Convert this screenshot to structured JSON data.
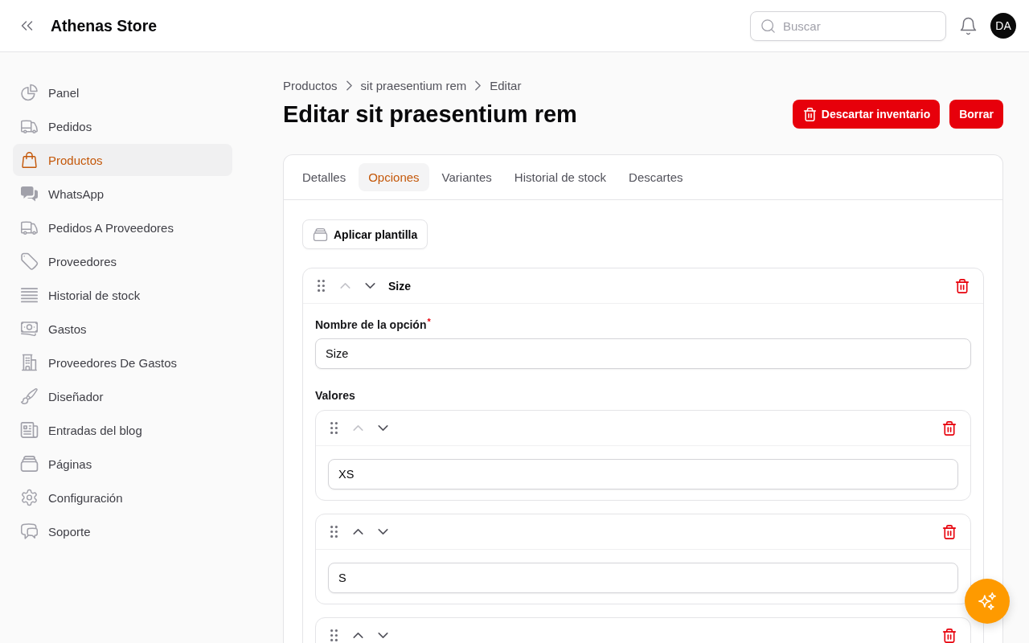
{
  "header": {
    "title": "Athenas Store",
    "search": {
      "placeholder": "Buscar"
    },
    "avatar": "DA"
  },
  "sidebar": {
    "items": [
      {
        "label": "Panel",
        "selected": false
      },
      {
        "label": "Pedidos",
        "selected": false
      },
      {
        "label": "Productos",
        "selected": true
      },
      {
        "label": "WhatsApp",
        "selected": false
      },
      {
        "label": "Pedidos A Proveedores",
        "selected": false
      },
      {
        "label": "Proveedores",
        "selected": false
      },
      {
        "label": "Historial de stock",
        "selected": false
      },
      {
        "label": "Gastos",
        "selected": false
      },
      {
        "label": "Proveedores De Gastos",
        "selected": false
      },
      {
        "label": "Diseñador",
        "selected": false
      },
      {
        "label": "Entradas del blog",
        "selected": false
      },
      {
        "label": "Páginas",
        "selected": false
      },
      {
        "label": "Configuración",
        "selected": false
      },
      {
        "label": "Soporte",
        "selected": false
      }
    ]
  },
  "breadcrumb": [
    "Productos",
    "sit praesentium rem",
    "Editar"
  ],
  "page_title": "Editar sit praesentium rem",
  "actions": [
    {
      "label": "Descartar inventario",
      "kind": "discard"
    },
    {
      "label": "Borrar",
      "kind": "delete"
    }
  ],
  "product_card": {
    "tabs": [
      {
        "label": "Detalles",
        "selected": false
      },
      {
        "label": "Opciones",
        "selected": true
      },
      {
        "label": "Variantes",
        "selected": false
      },
      {
        "label": "Historial de stock",
        "selected": false
      },
      {
        "label": "Descartes",
        "selected": false
      }
    ],
    "template_button": "Aplicar plantilla",
    "options": [
      {
        "title": "Size",
        "move_up_disabled": true,
        "move_down_disabled": false,
        "name_label": "Nombre de la opción",
        "required_mark": "*",
        "name_value": "Size",
        "values_label": "Valores",
        "values": [
          {
            "value": "XS",
            "move_up_disabled": true,
            "move_down_disabled": false
          },
          {
            "value": "S",
            "move_up_disabled": false,
            "move_down_disabled": false
          },
          {
            "move_up_disabled": false,
            "move_down_disabled": false
          }
        ]
      }
    ]
  }
}
